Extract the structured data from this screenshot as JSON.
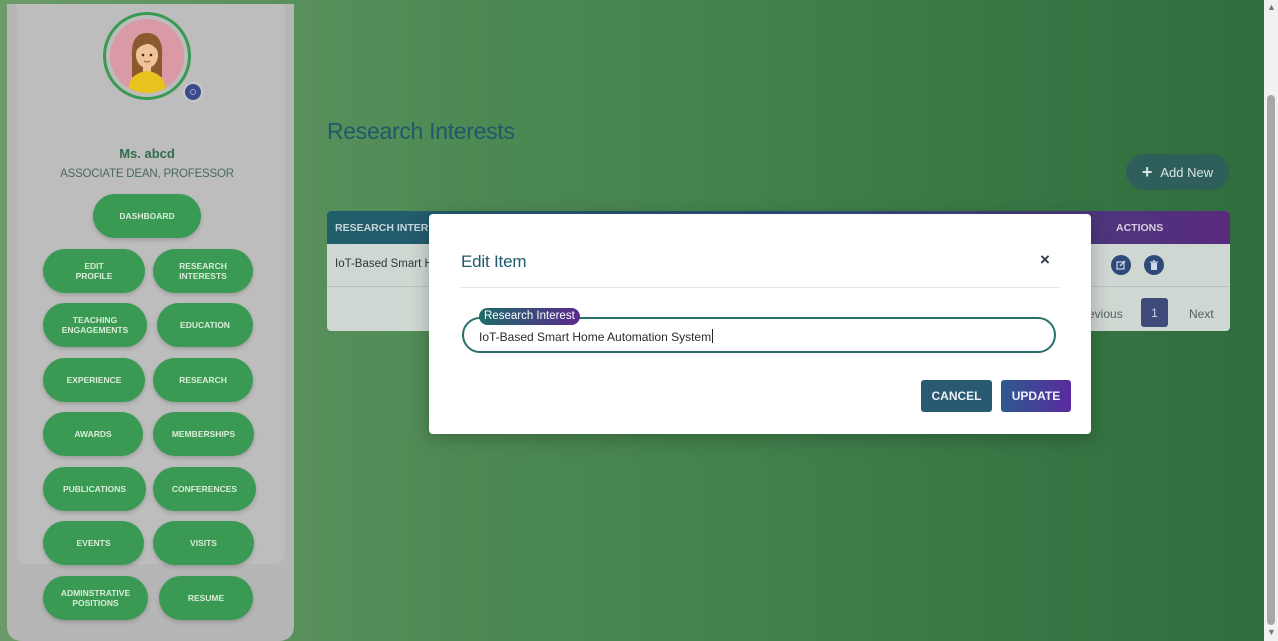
{
  "profile": {
    "name": "Ms. abcd",
    "title": "ASSOCIATE DEAN, PROFESSOR"
  },
  "sidebar": {
    "buttons": [
      {
        "label": "DASHBOARD"
      },
      {
        "label": "EDIT\nPROFILE"
      },
      {
        "label": "RESEARCH\nINTERESTS"
      },
      {
        "label": "TEACHING\nENGAGEMENTS"
      },
      {
        "label": "EDUCATION"
      },
      {
        "label": "EXPERIENCE"
      },
      {
        "label": "RESEARCH"
      },
      {
        "label": "AWARDS"
      },
      {
        "label": "MEMBERSHIPS"
      },
      {
        "label": "PUBLICATIONS"
      },
      {
        "label": "CONFERENCES"
      },
      {
        "label": "EVENTS"
      },
      {
        "label": "VISITS"
      },
      {
        "label": "ADMINSTRATIVE\nPOSITIONS"
      },
      {
        "label": "RESUME"
      }
    ]
  },
  "main": {
    "title": "Research Interests",
    "add_new_label": "Add New",
    "table": {
      "headers": [
        "RESEARCH INTERE",
        "ACTIONS"
      ],
      "rows": [
        {
          "text": "IoT-Based Smart H"
        }
      ]
    },
    "pagination": {
      "prev_label": "evious",
      "page": "1",
      "next_label": "Next"
    }
  },
  "modal": {
    "title": "Edit Item",
    "close_symbol": "×",
    "field_label": "Research Interest",
    "field_value": "IoT-Based Smart Home Automation System",
    "cancel_label": "CANCEL",
    "update_label": "UPDATE"
  },
  "colors": {
    "sidebar_button": "#3a9a53",
    "title_teal": "#1e5a6a",
    "accent_purple": "#5a2a8e"
  }
}
